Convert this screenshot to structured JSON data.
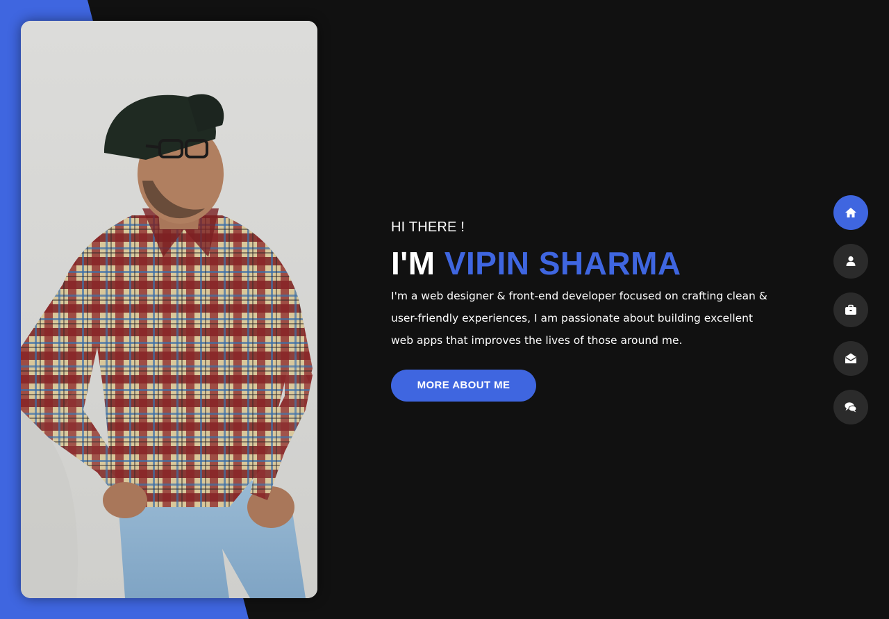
{
  "hero": {
    "greeting": "HI THERE !",
    "intro_prefix": "I'M ",
    "name": "VIPIN SHARMA",
    "description": "I'm a web designer & front-end developer focused on crafting clean & user-friendly experiences, I am passionate about building excellent web apps that improves the lives of those around me.",
    "cta_label": "MORE ABOUT ME"
  },
  "side_nav": {
    "items": [
      {
        "icon": "home-icon",
        "active": true
      },
      {
        "icon": "user-icon",
        "active": false
      },
      {
        "icon": "briefcase-icon",
        "active": false
      },
      {
        "icon": "envelope-open-icon",
        "active": false
      },
      {
        "icon": "comments-icon",
        "active": false
      }
    ]
  },
  "colors": {
    "accent": "#3f66e0",
    "background": "#111111",
    "nav_inactive": "#2b2b2b",
    "text": "#ffffff"
  }
}
